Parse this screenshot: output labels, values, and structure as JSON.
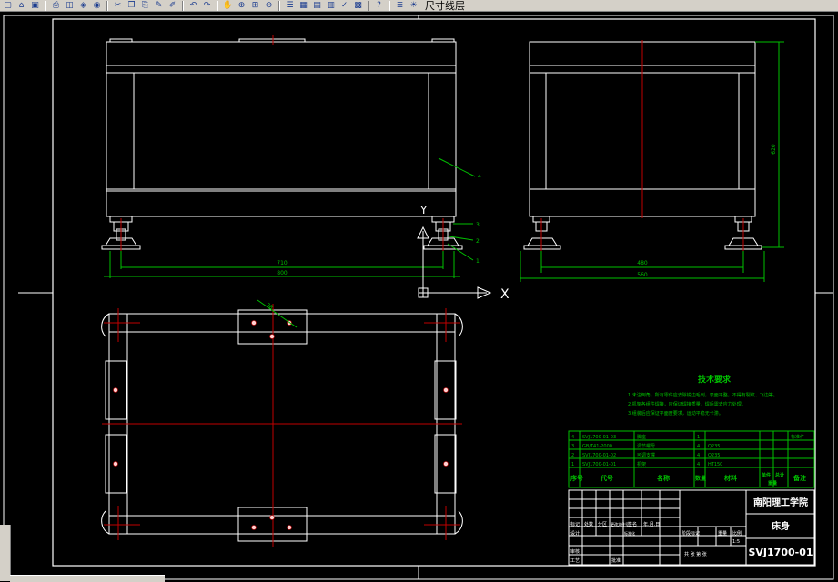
{
  "toolbar": {
    "buttons": [
      "new-file-icon",
      "open-file-icon",
      "save-icon",
      "print-icon",
      "plot-preview-icon",
      "publish-icon",
      "3d-dwf-icon",
      "cut-icon",
      "copy-icon",
      "paste-icon",
      "match-properties-icon",
      "block-editor-icon",
      "undo-icon",
      "redo-icon",
      "pan-icon",
      "zoom-realtime-icon",
      "zoom-window-icon",
      "zoom-previous-icon",
      "properties-icon",
      "design-center-icon",
      "tool-palettes-icon",
      "sheet-set-icon",
      "markup-icon",
      "quickcalc-icon",
      "help-icon",
      "layer-manager-icon",
      "layer-state-icon"
    ],
    "layer_name": "尺寸线层"
  },
  "drawing": {
    "tech_requirements_title": "技术要求",
    "tech_requirements": [
      "1.未注倒角，所有零件应去除锐边毛刺，表面平整，不得有裂纹、飞边等。",
      "2.机架各组件焊接，应保证焊接质量，焊后需去应力处理。",
      "3.组装后应保证平面度要求，运动平稳无卡滞。"
    ],
    "parts": [
      {
        "no": "4",
        "code": "SVJ1700-01-03",
        "name": "脚座",
        "qty": "1",
        "material": "",
        "remark": "标准件"
      },
      {
        "no": "3",
        "code": "GB/T41-2000",
        "name": "调节螺母",
        "qty": "4",
        "material": "Q235",
        "remark": ""
      },
      {
        "no": "2",
        "code": "SVJ1700-01-02",
        "name": "可调支撑",
        "qty": "4",
        "material": "Q235",
        "remark": ""
      },
      {
        "no": "1",
        "code": "SVJ1700-01-01",
        "name": "机架",
        "qty": "4",
        "material": "HT150",
        "remark": ""
      }
    ],
    "parts_header": {
      "no": "序号",
      "code": "代号",
      "name": "名称",
      "qty": "数量",
      "material": "材料",
      "unit_weight": "单件",
      "total_weight": "总计",
      "weight": "重量",
      "remark": "备注"
    },
    "school": "南阳理工学院",
    "part_title": "床身",
    "drawing_number": "SVJ1700-01",
    "scale": "1:5",
    "sheet": "共 张 第 张",
    "tb_labels": {
      "mark": "标记",
      "count": "处数",
      "zone": "分区",
      "change_doc": "更改文件号",
      "sign": "签名",
      "date": "年.月.日",
      "design": "设计",
      "standardize": "标准化",
      "stage_mark": "阶段标记",
      "weight": "重量",
      "scale": "比例",
      "review": "审核",
      "process": "工艺",
      "approve": "批准"
    },
    "dim_labels": {
      "inner_width": "710",
      "overall_width": "800",
      "side_width": "480",
      "side_overall": "560",
      "height": "620",
      "angle_dim": "38"
    },
    "balloons": [
      "4",
      "3",
      "2",
      "1"
    ],
    "ucs": {
      "x": "X",
      "y": "Y"
    }
  }
}
